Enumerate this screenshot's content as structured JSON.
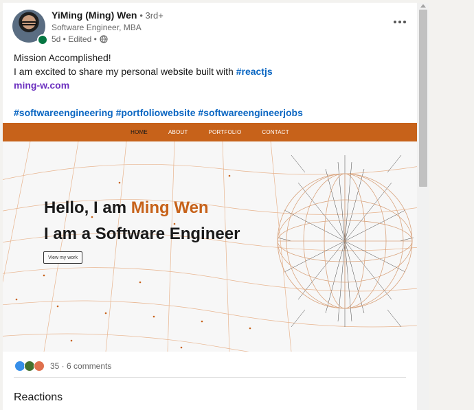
{
  "author": {
    "name": "YiMing (Ming) Wen",
    "degree": "• 3rd+",
    "headline": "Software Engineer, MBA",
    "meta": "5d • Edited •"
  },
  "post": {
    "line1": "Mission Accomplished!",
    "line2_prefix": "I am excited to share my personal website built with ",
    "line2_hashtag": "#reactjs",
    "link": "ming-w.com",
    "hashtags": "#softwareengineering #portfoliowebsite #softwareengineerjobs"
  },
  "preview": {
    "nav": [
      "HOME",
      "ABOUT",
      "PORTFOLIO",
      "CONTACT"
    ],
    "hero_prefix": "Hello, I am ",
    "hero_name": "Ming Wen",
    "hero_line2": "I am a Software Engineer",
    "cta": "View my work"
  },
  "social": {
    "counts": "35 · 6 comments",
    "reactions_title": "Reactions"
  },
  "colors": {
    "accent": "#c7621a",
    "hashtag": "#0a66c2",
    "link": "#6b2fbf",
    "presence": "#057642"
  },
  "icons": [
    "globe-icon",
    "more-icon",
    "like-icon",
    "celebrate-icon",
    "love-icon"
  ]
}
